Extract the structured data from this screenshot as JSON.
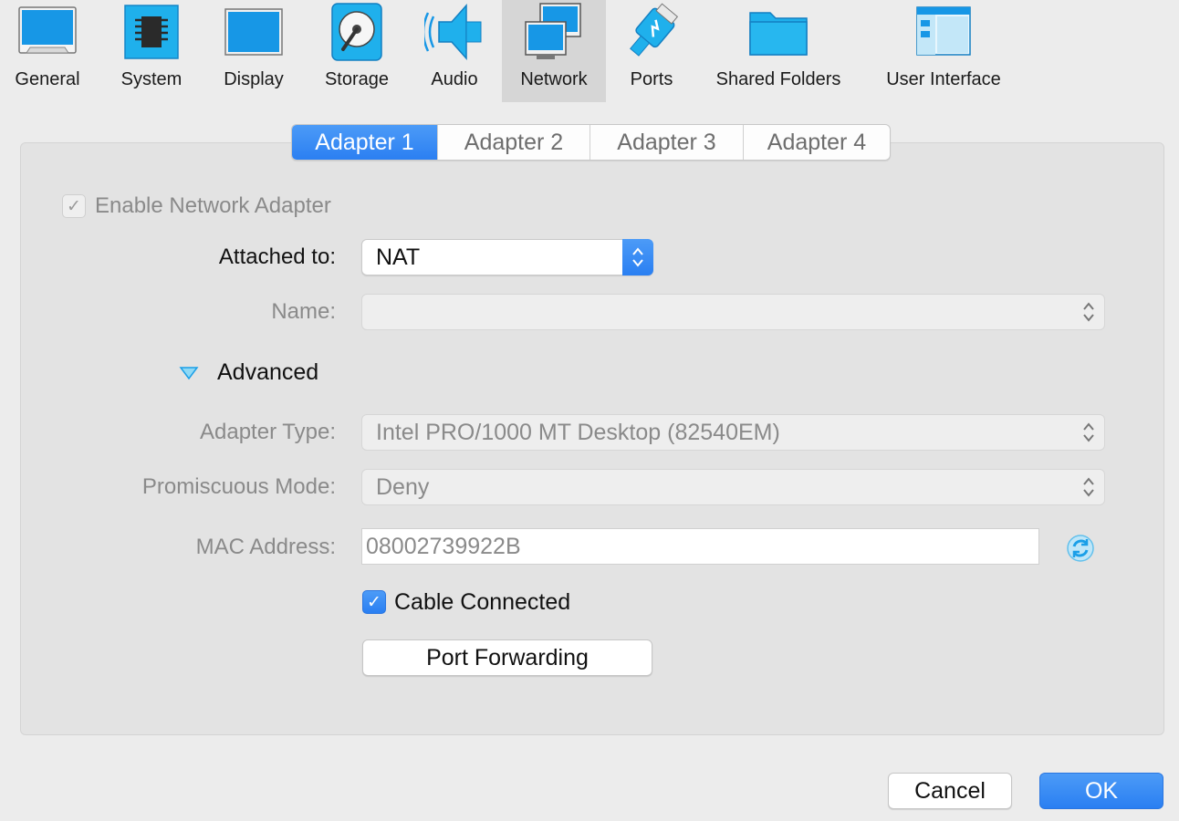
{
  "toolbar": {
    "items": [
      {
        "label": "General",
        "icon": "general-icon"
      },
      {
        "label": "System",
        "icon": "chip-icon"
      },
      {
        "label": "Display",
        "icon": "monitor-icon"
      },
      {
        "label": "Storage",
        "icon": "disk-icon"
      },
      {
        "label": "Audio",
        "icon": "speaker-icon"
      },
      {
        "label": "Network",
        "icon": "network-icon",
        "selected": true
      },
      {
        "label": "Ports",
        "icon": "plug-icon"
      },
      {
        "label": "Shared Folders",
        "icon": "folder-icon"
      },
      {
        "label": "User Interface",
        "icon": "window-icon"
      }
    ]
  },
  "tabs": [
    "Adapter 1",
    "Adapter 2",
    "Adapter 3",
    "Adapter 4"
  ],
  "active_tab": "Adapter 1",
  "adapter": {
    "enable_label": "Enable Network Adapter",
    "enable_checked": true,
    "attached_label": "Attached to:",
    "attached_value": "NAT",
    "name_label": "Name:",
    "name_value": "",
    "advanced_label": "Advanced",
    "adapter_type_label": "Adapter Type:",
    "adapter_type_value": "Intel PRO/1000 MT Desktop (82540EM)",
    "promiscuous_label": "Promiscuous Mode:",
    "promiscuous_value": "Deny",
    "mac_label": "MAC Address:",
    "mac_value": "08002739922B",
    "cable_label": "Cable Connected",
    "cable_checked": true,
    "port_forwarding_label": "Port Forwarding"
  },
  "footer": {
    "cancel_label": "Cancel",
    "ok_label": "OK"
  },
  "colors": {
    "accent": "#2b7ff2",
    "icon_blue": "#1a9fe8",
    "background": "#ececec"
  }
}
